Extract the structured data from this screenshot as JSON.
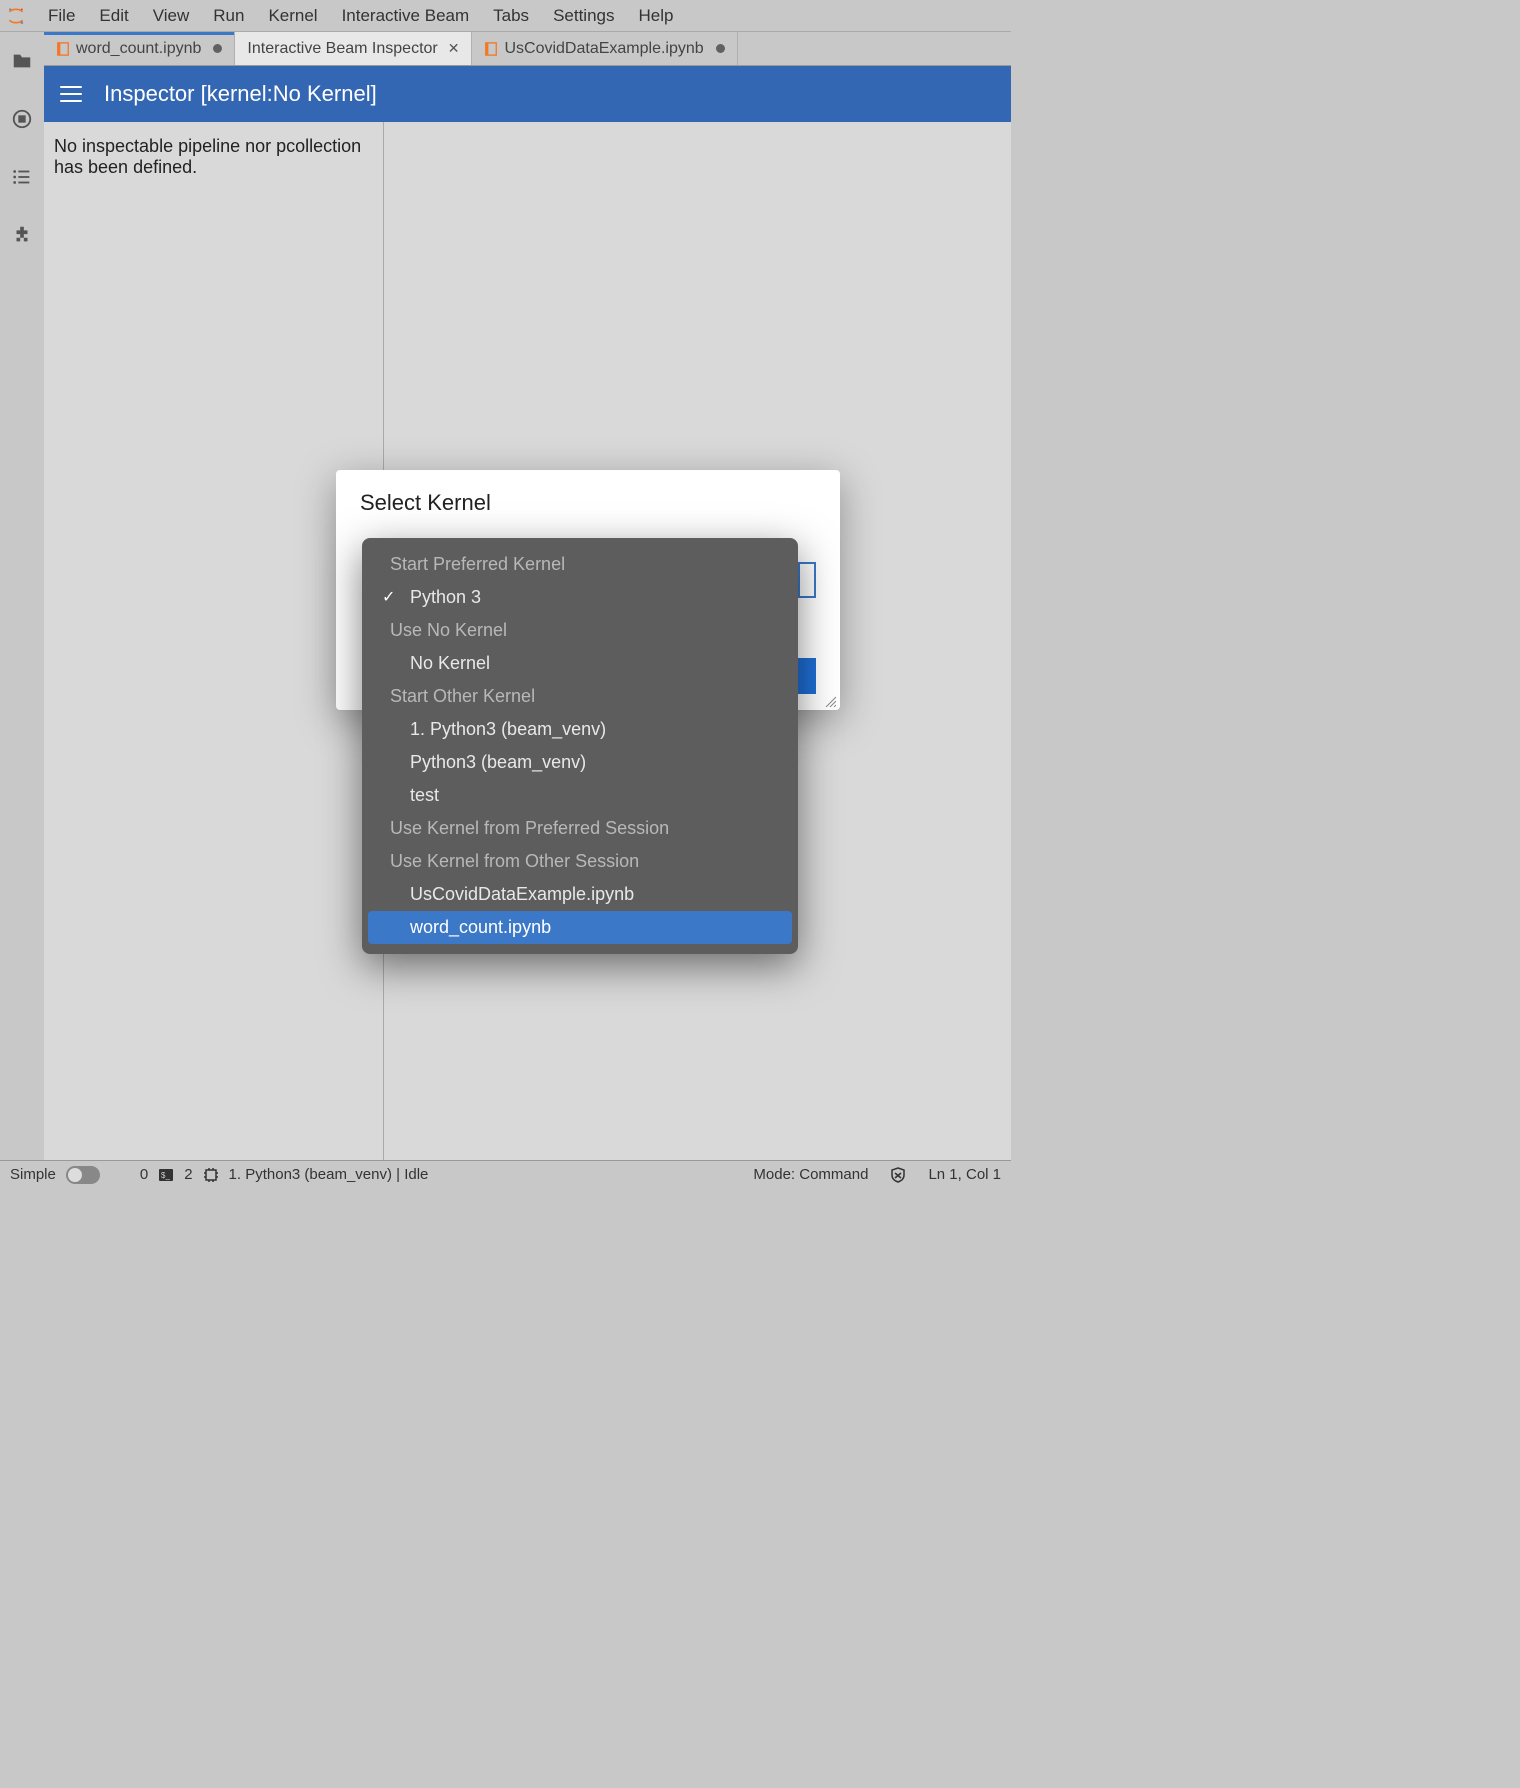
{
  "menubar": {
    "items": [
      "File",
      "Edit",
      "View",
      "Run",
      "Kernel",
      "Interactive Beam",
      "Tabs",
      "Settings",
      "Help"
    ]
  },
  "tabs": [
    {
      "label": "word_count.ipynb",
      "dirty": true,
      "icon": "notebook",
      "active": false,
      "closable": false,
      "blueTop": true
    },
    {
      "label": "Interactive Beam Inspector",
      "dirty": false,
      "icon": null,
      "active": true,
      "closable": true,
      "blueTop": false
    },
    {
      "label": "UsCovidDataExample.ipynb",
      "dirty": true,
      "icon": "notebook",
      "active": false,
      "closable": false,
      "blueTop": false
    }
  ],
  "inspector": {
    "title": "Inspector [kernel:No Kernel]",
    "empty_message": "No inspectable pipeline nor pcollection has been defined."
  },
  "dialog": {
    "title": "Select Kernel"
  },
  "dropdown": {
    "groups": [
      {
        "label": "Start Preferred Kernel",
        "items": [
          {
            "label": "Python 3",
            "checked": true
          }
        ]
      },
      {
        "label": "Use No Kernel",
        "items": [
          {
            "label": "No Kernel"
          }
        ]
      },
      {
        "label": "Start Other Kernel",
        "items": [
          {
            "label": "1. Python3 (beam_venv)"
          },
          {
            "label": "Python3 (beam_venv)"
          },
          {
            "label": "test"
          }
        ]
      },
      {
        "label": "Use Kernel from Preferred Session",
        "items": []
      },
      {
        "label": "Use Kernel from Other Session",
        "items": [
          {
            "label": "UsCovidDataExample.ipynb"
          },
          {
            "label": "word_count.ipynb",
            "highlight": true
          }
        ]
      }
    ]
  },
  "statusbar": {
    "simple_label": "Simple",
    "tab_count": "0",
    "terminal_count": "2",
    "kernel_status": "1. Python3 (beam_venv) | Idle",
    "mode": "Mode: Command",
    "cursor": "Ln 1, Col 1"
  }
}
